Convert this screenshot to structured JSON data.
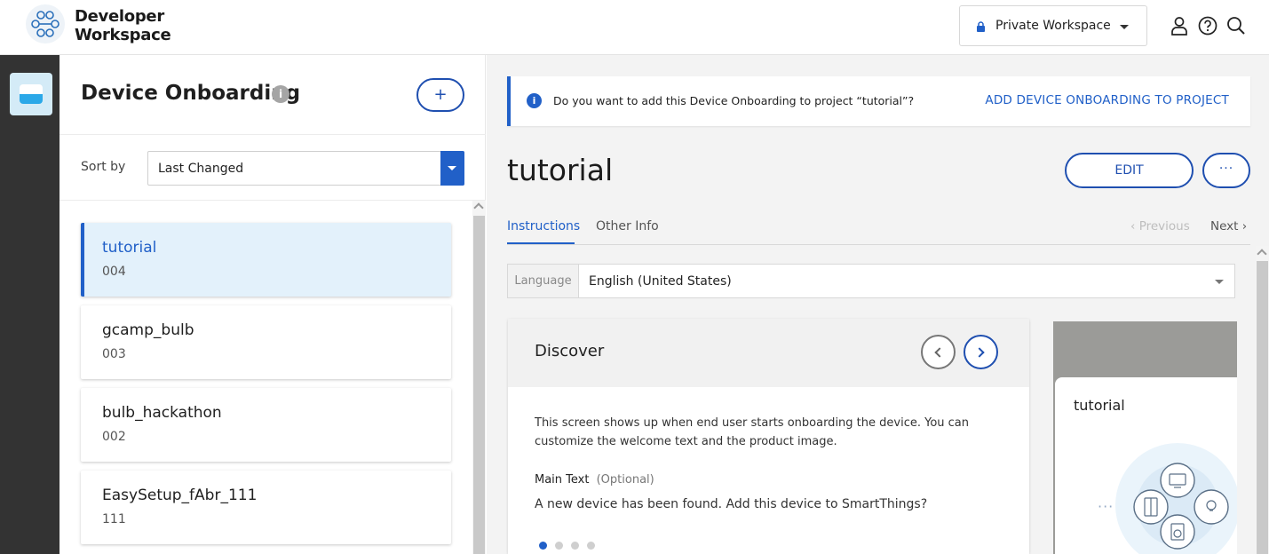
{
  "header": {
    "brand_line1": "Developer",
    "brand_line2": "Workspace",
    "workspace_label": "Private Workspace",
    "icons": [
      "account-icon",
      "help-icon",
      "search-icon"
    ]
  },
  "rail": {
    "items": [
      {
        "icon": "device-onboarding-icon",
        "active": true
      }
    ]
  },
  "list_panel": {
    "title": "Device Onboarding",
    "info_icon": "i",
    "add_label": "+",
    "sort_label": "Sort by",
    "sort_value": "Last Changed",
    "items": [
      {
        "name": "tutorial",
        "number": "004",
        "selected": true
      },
      {
        "name": "gcamp_bulb",
        "number": "003",
        "selected": false
      },
      {
        "name": "bulb_hackathon",
        "number": "002",
        "selected": false
      },
      {
        "name": "EasySetup_fAbr_111",
        "number": "111",
        "selected": false
      }
    ]
  },
  "banner": {
    "icon": "i",
    "text": "Do you want to add this Device Onboarding to project “tutorial”?",
    "action": "ADD DEVICE ONBOARDING TO PROJECT"
  },
  "detail": {
    "title": "tutorial",
    "edit_label": "EDIT",
    "more_label": "···",
    "tabs": [
      {
        "label": "Instructions",
        "active": true
      },
      {
        "label": "Other Info",
        "active": false
      }
    ],
    "prev_label": "‹ Previous",
    "next_label": "Next ›",
    "language_label": "Language",
    "language_value": "English (United States)",
    "step": {
      "title": "Discover",
      "description": "This screen shows up when end user starts onboarding the device. You can customize the welcome text and the product image.",
      "main_text_label": "Main Text",
      "main_text_optional": "(Optional)",
      "main_text_value": "A new device has been found. Add this device to SmartThings?",
      "page_index": 1,
      "page_count": 4
    },
    "preview": {
      "title": "tutorial",
      "dots": "···"
    }
  },
  "colors": {
    "accent": "#2160c8",
    "rail": "#333333",
    "selected_bg": "#e3f1fb"
  }
}
